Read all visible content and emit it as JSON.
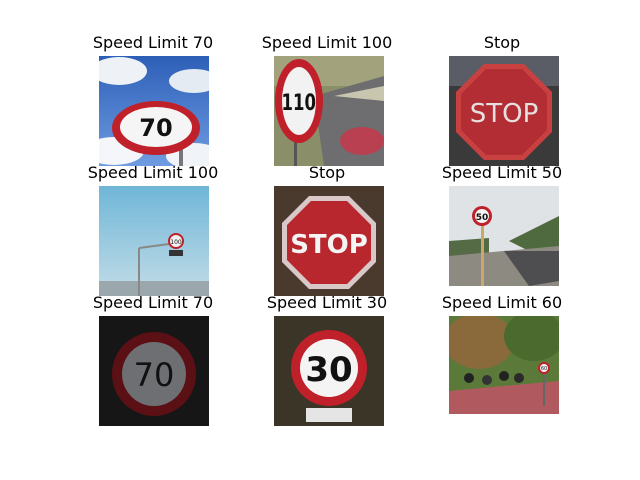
{
  "grid": {
    "rows": 3,
    "cols": 3,
    "cells": [
      {
        "title": "Speed Limit 70",
        "sign": "70",
        "kind": "speed",
        "scene": "sky"
      },
      {
        "title": "Speed Limit 100",
        "sign": "110",
        "kind": "speed",
        "scene": "road"
      },
      {
        "title": "Stop",
        "sign": "STOP",
        "kind": "stop",
        "scene": "dark"
      },
      {
        "title": "Speed Limit 100",
        "sign": "100",
        "kind": "speed",
        "scene": "pale-sky"
      },
      {
        "title": "Stop",
        "sign": "STOP",
        "kind": "stop",
        "scene": "dark"
      },
      {
        "title": "Speed Limit 50",
        "sign": "50",
        "kind": "speed",
        "scene": "coast"
      },
      {
        "title": "Speed Limit 70",
        "sign": "70",
        "kind": "speed",
        "scene": "night"
      },
      {
        "title": "Speed Limit 30",
        "sign": "30",
        "kind": "speed",
        "scene": "dark"
      },
      {
        "title": "Speed Limit 60",
        "sign": "60",
        "kind": "speed",
        "scene": "cyclists"
      }
    ]
  },
  "colors": {
    "sign_red": "#c0202a",
    "sign_white": "#f2f2f2",
    "sign_text": "#111111"
  }
}
